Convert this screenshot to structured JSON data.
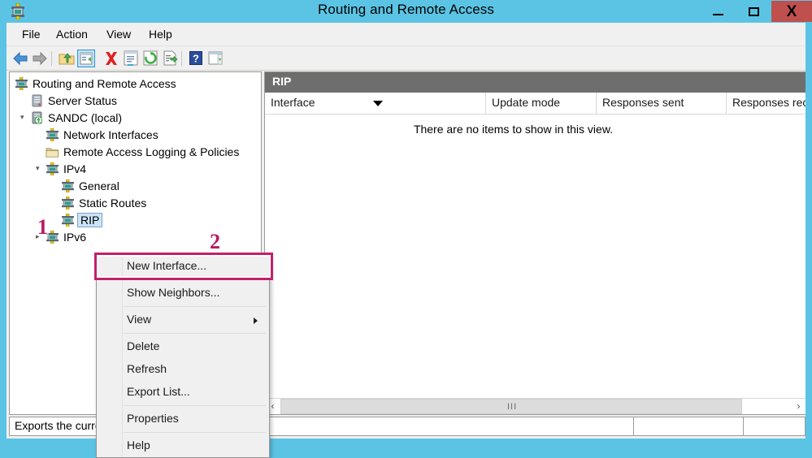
{
  "window": {
    "title": "Routing and Remote Access",
    "app_icon": "router-icon",
    "minimize_label": "Minimize",
    "maximize_label": "Maximize",
    "close_label": "X",
    "close_color": "#c0504d",
    "frame_color": "#5bc4e4"
  },
  "menubar": {
    "items": [
      {
        "label": "File"
      },
      {
        "label": "Action"
      },
      {
        "label": "View"
      },
      {
        "label": "Help"
      }
    ]
  },
  "toolbar": {
    "items": [
      {
        "name": "back-icon"
      },
      {
        "name": "forward-icon"
      },
      {
        "name": "up-folder-icon"
      },
      {
        "name": "show-hide-console-tree-icon"
      },
      {
        "name": "delete-icon"
      },
      {
        "name": "properties-icon"
      },
      {
        "name": "refresh-icon"
      },
      {
        "name": "export-list-icon"
      },
      {
        "name": "help-icon"
      },
      {
        "name": "show-hide-action-pane-icon"
      }
    ]
  },
  "tree": {
    "nodes": [
      {
        "label": "Routing and Remote Access",
        "icon": "router-icon",
        "indent": 0,
        "expander": "",
        "selected": false
      },
      {
        "label": "Server Status",
        "icon": "server-icon",
        "indent": 1,
        "expander": "",
        "selected": false
      },
      {
        "label": "SANDC (local)",
        "icon": "server-node-icon",
        "indent": 1,
        "expander": "expanded",
        "selected": false
      },
      {
        "label": "Network Interfaces",
        "icon": "router-icon",
        "indent": 2,
        "expander": "",
        "selected": false
      },
      {
        "label": "Remote Access Logging & Policies",
        "icon": "folder-icon",
        "indent": 2,
        "expander": "",
        "selected": false
      },
      {
        "label": "IPv4",
        "icon": "router-icon",
        "indent": 2,
        "expander": "expanded",
        "selected": false
      },
      {
        "label": "General",
        "icon": "router-icon",
        "indent": 3,
        "expander": "",
        "selected": false
      },
      {
        "label": "Static Routes",
        "icon": "router-icon",
        "indent": 3,
        "expander": "",
        "selected": false
      },
      {
        "label": "RIP",
        "icon": "router-icon",
        "indent": 3,
        "expander": "",
        "selected": true
      },
      {
        "label": "IPv6",
        "icon": "router-icon",
        "indent": 2,
        "expander": "collapsed",
        "selected": false
      }
    ]
  },
  "list_pane": {
    "header": "RIP",
    "header_bg": "#6e6e6e",
    "columns": [
      {
        "label": "Interface",
        "sorted": true,
        "sort_direction": "descending"
      },
      {
        "label": "Update mode",
        "sorted": false,
        "sort_direction": ""
      },
      {
        "label": "Responses sent",
        "sorted": false,
        "sort_direction": ""
      },
      {
        "label": "Responses rec",
        "sorted": false,
        "sort_direction": ""
      }
    ],
    "rows": [],
    "empty_message": "There are no items to show in this view.",
    "scrollbar": {
      "left_arrow": "‹",
      "right_arrow": "›",
      "grip": "III"
    }
  },
  "context_menu": {
    "items": [
      {
        "label": "New Interface...",
        "highlighted": true,
        "submenu": false,
        "separator_after": true
      },
      {
        "label": "Show Neighbors...",
        "highlighted": false,
        "submenu": false,
        "separator_after": true
      },
      {
        "label": "View",
        "highlighted": false,
        "submenu": true,
        "separator_after": true
      },
      {
        "label": "Delete",
        "highlighted": false,
        "submenu": false,
        "separator_after": false
      },
      {
        "label": "Refresh",
        "highlighted": false,
        "submenu": false,
        "separator_after": false
      },
      {
        "label": "Export List...",
        "highlighted": false,
        "submenu": false,
        "separator_after": true
      },
      {
        "label": "Properties",
        "highlighted": false,
        "submenu": false,
        "separator_after": true
      },
      {
        "label": "Help",
        "highlighted": false,
        "submenu": false,
        "separator_after": false
      }
    ],
    "highlight_color": "#c2206c"
  },
  "statusbar": {
    "panel1": "Exports the current list to a file.",
    "panel2": "",
    "panel3": ""
  },
  "annotations": {
    "marker1": "1",
    "marker2": "2",
    "color": "#b51b63"
  }
}
